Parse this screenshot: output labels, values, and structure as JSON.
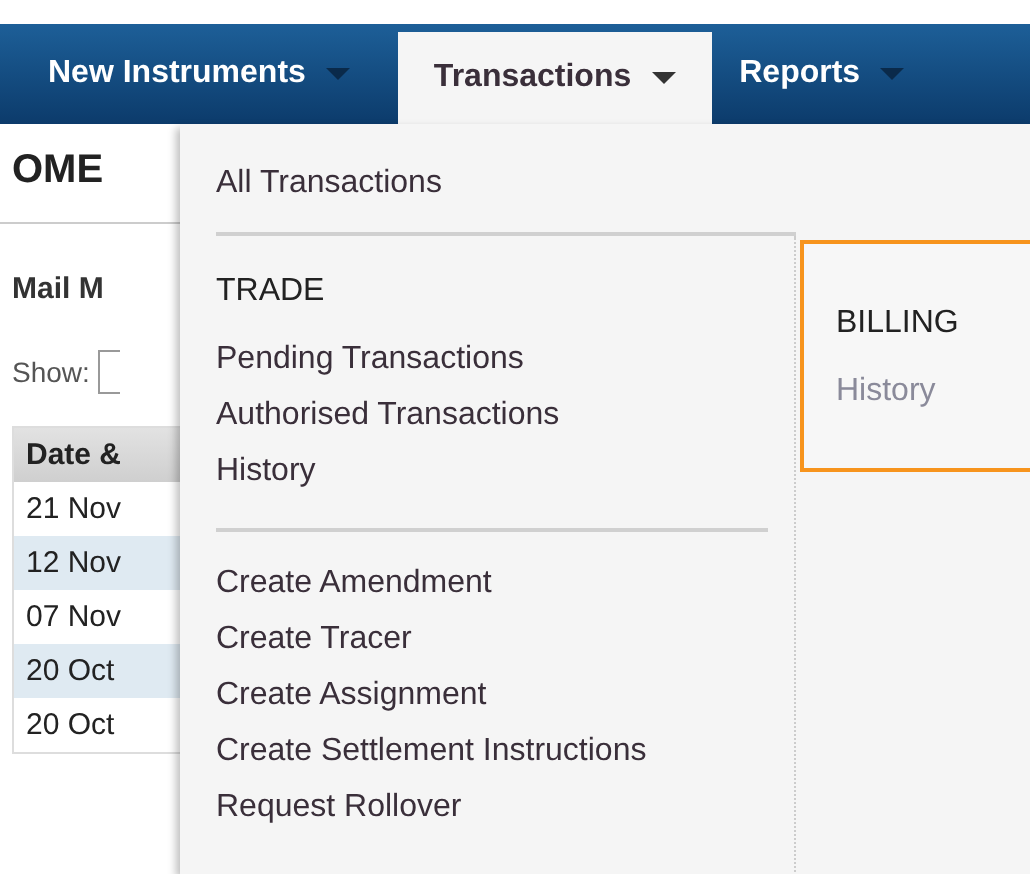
{
  "nav": {
    "tabs": [
      {
        "label": "New Instruments",
        "selected": false
      },
      {
        "label": "Transactions",
        "selected": true
      },
      {
        "label": "Reports",
        "selected": false
      }
    ]
  },
  "page": {
    "title": "OME",
    "section": "Mail M",
    "show_label": "Show:",
    "table": {
      "header": "Date &",
      "rows": [
        "21 Nov",
        "12 Nov",
        "07 Nov",
        "20 Oct",
        "20 Oct"
      ]
    }
  },
  "menu": {
    "top_item": "All Transactions",
    "columns": [
      {
        "highlighted": false,
        "groups": [
          {
            "heading": "TRADE",
            "items": [
              {
                "label": "Pending Transactions",
                "disabled": false
              },
              {
                "label": "Authorised Transactions",
                "disabled": false
              },
              {
                "label": "History",
                "disabled": false
              }
            ]
          },
          {
            "items": [
              {
                "label": "Create Amendment",
                "disabled": false
              },
              {
                "label": "Create Tracer",
                "disabled": false
              },
              {
                "label": "Create Assignment",
                "disabled": false
              },
              {
                "label": "Create Settlement Instructions",
                "disabled": false
              },
              {
                "label": "Request Rollover",
                "disabled": false
              }
            ]
          }
        ]
      },
      {
        "highlighted": true,
        "groups": [
          {
            "heading": "BILLING",
            "items": [
              {
                "label": "History",
                "disabled": true
              }
            ]
          }
        ]
      }
    ]
  }
}
